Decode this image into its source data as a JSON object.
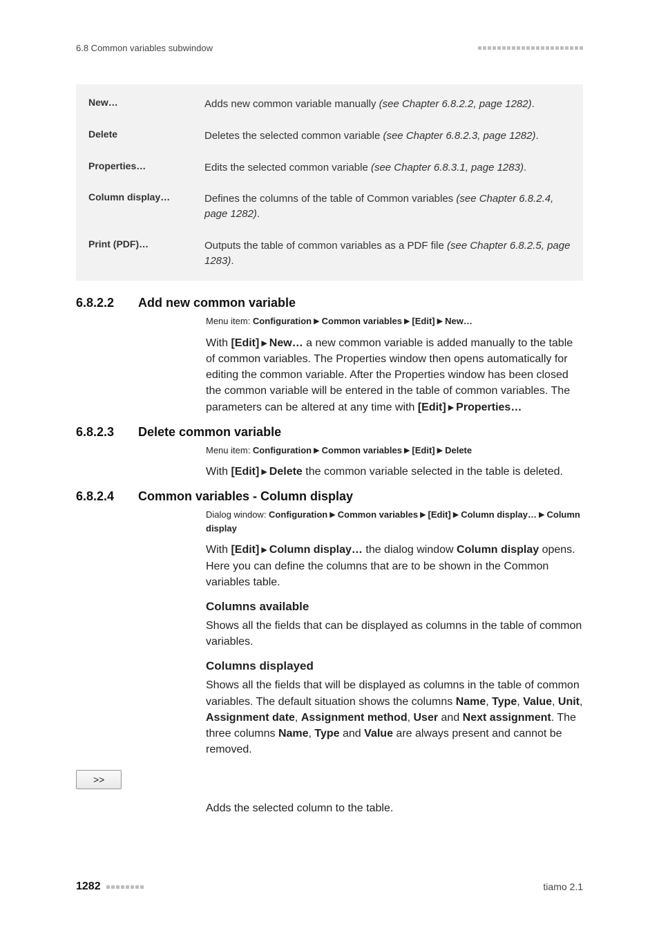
{
  "header": {
    "section_label": "6.8 Common variables subwindow"
  },
  "deflist": {
    "items": [
      {
        "term": "New…",
        "desc_pre": "Adds new common variable manually ",
        "ref": "(see Chapter 6.8.2.2, page 1282)",
        "desc_post": "."
      },
      {
        "term": "Delete",
        "desc_pre": "Deletes the selected common variable ",
        "ref": "(see Chapter 6.8.2.3, page 1282)",
        "desc_post": "."
      },
      {
        "term": "Properties…",
        "desc_pre": "Edits the selected common variable ",
        "ref": "(see Chapter 6.8.3.1, page 1283)",
        "desc_post": "."
      },
      {
        "term": "Column display…",
        "desc_pre": "Defines the columns of the table of Common variables ",
        "ref": "(see Chapter 6.8.2.4, page 1282)",
        "desc_post": "."
      },
      {
        "term": "Print (PDF)…",
        "desc_pre": "Outputs the table of common variables as a PDF file ",
        "ref": "(see Chapter 6.8.2.5, page 1283)",
        "desc_post": "."
      }
    ]
  },
  "s1": {
    "num": "6.8.2.2",
    "title": "Add new common variable",
    "menu_prefix": "Menu item: ",
    "m1": "Configuration",
    "m2": "Common variables",
    "m3": "[Edit]",
    "m4": "New…",
    "p_w1": "With ",
    "p_e1": "[Edit]",
    "p_e2": "New…",
    "p_rest": " a new common variable is added manually to the table of common variables. The Properties window then opens automatically for editing the common variable. After the Properties window has been closed the common variable will be entered in the table of common variables. The parameters can be altered at any time with ",
    "p_e3": "[Edit]",
    "p_e4": "Properties…"
  },
  "s2": {
    "num": "6.8.2.3",
    "title": "Delete common variable",
    "menu_prefix": "Menu item: ",
    "m1": "Configuration",
    "m2": "Common variables",
    "m3": "[Edit]",
    "m4": "Delete",
    "p_w1": "With ",
    "p_e1": "[Edit]",
    "p_e2": "Delete",
    "p_rest": " the common variable selected in the table is deleted."
  },
  "s3": {
    "num": "6.8.2.4",
    "title": "Common variables - Column display",
    "dlg_prefix": "Dialog window: ",
    "m1": "Configuration",
    "m2": "Common variables",
    "m3": "[Edit]",
    "m4": "Column display…",
    "m5": "Column display",
    "p_w1": "With ",
    "p_e1": "[Edit]",
    "p_e2": "Column display…",
    "p_mid": " the dialog window ",
    "p_e3": "Column display",
    "p_rest": " opens. Here you can define the columns that are to be shown in the Common variables table.",
    "h1": "Columns available",
    "h1_text": "Shows all the fields that can be displayed as columns in the table of common variables.",
    "h2": "Columns displayed",
    "h2_t1": "Shows all the fields that will be displayed as columns in the table of common variables. The default situation shows the columns ",
    "b_name": "Name",
    "b_type": "Type",
    "b_value": "Value",
    "b_unit": "Unit",
    "b_adate": "Assignment date",
    "b_amethod": "Assignment method",
    "b_user": "User",
    "b_next": "Next assignment",
    "h2_t2a": ". The three columns ",
    "h2_t2b": " and ",
    "h2_t2c": " are always present and cannot be removed.",
    "btn_label": ">>",
    "btn_text": "Adds the selected column to the table."
  },
  "footer": {
    "page": "1282",
    "product": "tiamo 2.1"
  },
  "sep": ", ",
  "and": " and "
}
